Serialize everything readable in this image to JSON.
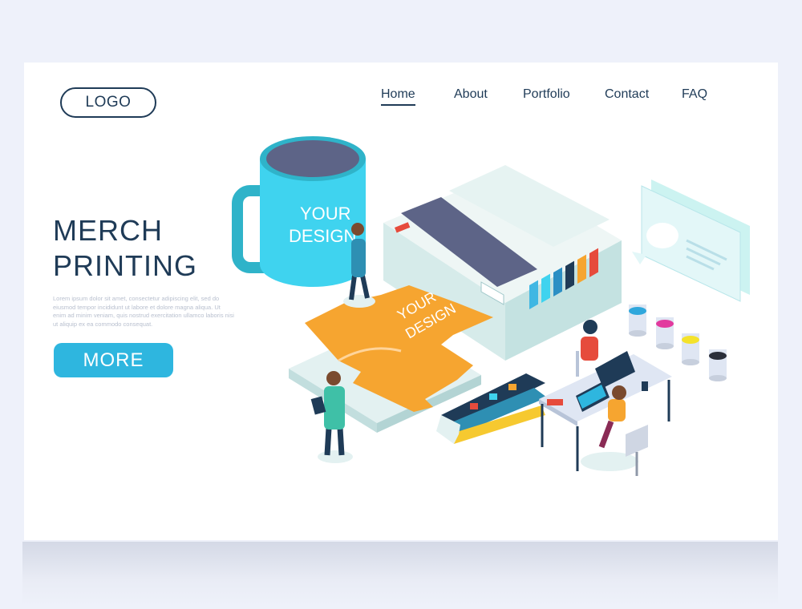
{
  "logo": {
    "label": "LOGO"
  },
  "nav": {
    "items": [
      {
        "label": "Home",
        "active": true
      },
      {
        "label": "About",
        "active": false
      },
      {
        "label": "Portfolio",
        "active": false
      },
      {
        "label": "Contact",
        "active": false
      },
      {
        "label": "FAQ",
        "active": false
      }
    ]
  },
  "hero": {
    "title_line1": "MERCH",
    "title_line2": "PRINTING",
    "body": "Lorem ipsum dolor sit amet, consectetur adipiscing elit, sed do eiusmod tempor incididunt ut labore et dolore magna aliqua. Ut enim ad minim veniam, quis nostrud exercitation ullamco laboris nisi ut aliquip ex ea commodo consequat.",
    "button_label": "MORE"
  },
  "illustration": {
    "mug_text_line1": "YOUR",
    "mug_text_line2": "DESIGN",
    "shirt_text_line1": "YOUR",
    "shirt_text_line2": "DESIGN"
  },
  "colors": {
    "brand_dark": "#1f3b57",
    "accent_blue": "#2eb6df",
    "mug": "#3fd3ef",
    "shirt": "#f6a530",
    "printer_body": "#dfeeee",
    "paint_cyan": "#2fa7dc",
    "paint_magenta": "#e23a9e",
    "paint_yellow": "#f4e22b",
    "paint_black": "#2b2f3a"
  }
}
